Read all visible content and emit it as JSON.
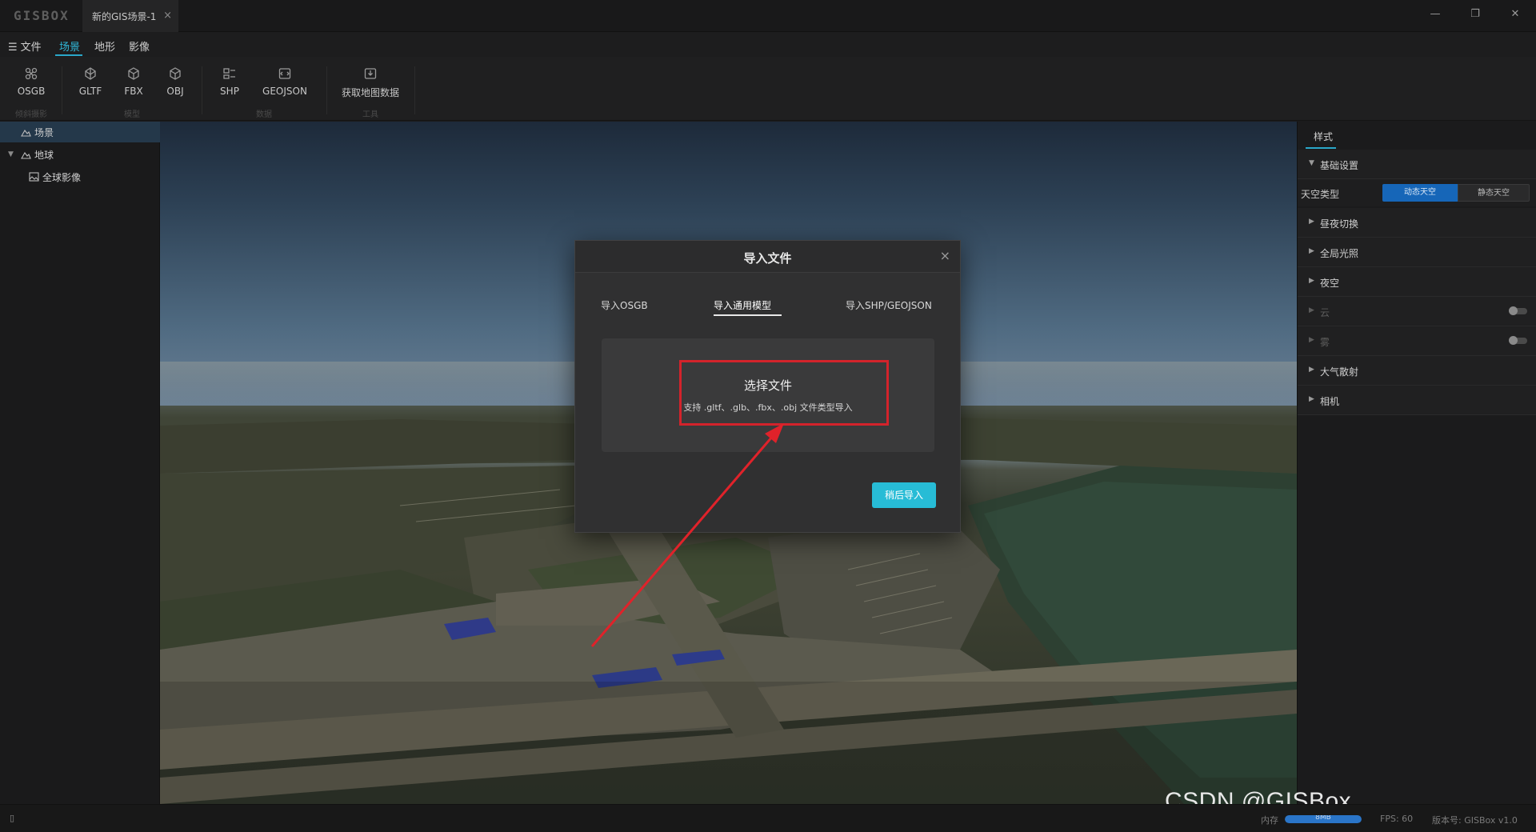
{
  "app": {
    "logo": "GISBOX",
    "doc_tab": "新的GIS场景-1",
    "tab_close": "×",
    "win_min": "—",
    "win_max": "❐",
    "win_close": "✕"
  },
  "menu": {
    "file": "文件",
    "scene": "场景",
    "terrain": "地形",
    "image": "影像"
  },
  "toolbar": {
    "osgb": "OSGB",
    "gltf": "GLTF",
    "fbx": "FBX",
    "obj": "OBJ",
    "shp": "SHP",
    "geojson": "GEOJSON",
    "fetch_map": "获取地图数据",
    "group_oblique": "倾斜摄影",
    "group_model": "模型",
    "group_data": "数据",
    "group_tools": "工具"
  },
  "tree": {
    "scene": "场景",
    "globe": "地球",
    "global_image": "全球影像"
  },
  "dialog": {
    "title": "导入文件",
    "close": "×",
    "tab_osgb": "导入OSGB",
    "tab_model": "导入通用模型",
    "tab_shp": "导入SHP/GEOJSON",
    "choose_file": "选择文件",
    "hint": "支持 .gltf、.glb、.fbx、.obj 文件类型导入",
    "later_button": "稍后导入"
  },
  "right_panel": {
    "tab_style": "样式",
    "basic_settings": "基础设置",
    "sky_type_label": "天空类型",
    "sky_dynamic": "动态天空",
    "sky_static": "静态天空",
    "day_night": "昼夜切换",
    "global_light": "全局光照",
    "night_sky": "夜空",
    "cloud": "云",
    "fog": "雾",
    "atmosphere": "大气散射",
    "camera": "相机"
  },
  "status": {
    "memory_label": "内存",
    "memory_value": "8MB",
    "fps": "FPS: 60",
    "version": "版本号: GISBox v1.0"
  },
  "watermark": "CSDN @GISBox",
  "colors": {
    "accent": "#2aa7c9",
    "highlight_red": "#d3232b",
    "button": "#27bcd6",
    "segment_active": "#1666b8"
  }
}
